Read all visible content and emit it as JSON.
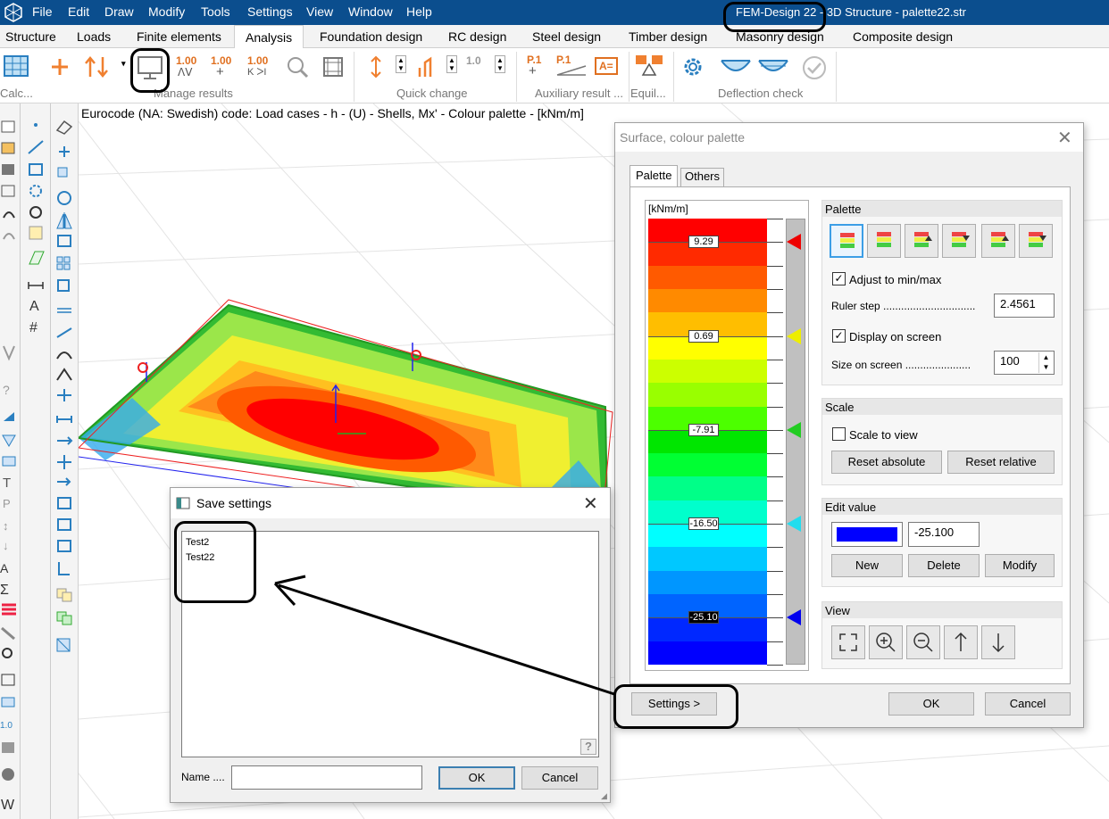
{
  "app": {
    "title": "FEM-Design 22 - 3D Structure - palette22.str"
  },
  "menu": [
    "File",
    "Edit",
    "Draw",
    "Modify",
    "Tools",
    "Settings",
    "View",
    "Window",
    "Help"
  ],
  "tabs": [
    "Structure",
    "Loads",
    "Finite elements",
    "Analysis",
    "Foundation design",
    "RC design",
    "Steel design",
    "Timber design",
    "Masonry design",
    "Composite design"
  ],
  "active_tab": "Analysis",
  "ribbon": {
    "groups": [
      "Calc...",
      "Manage results",
      "Quick change",
      "Auxiliary result ...",
      "Equil...",
      "Deflection check"
    ],
    "num_labels": [
      "1.00",
      "1.00",
      "1.00",
      "1.0"
    ],
    "aux_labels": [
      "P.1",
      "P.1",
      "A="
    ]
  },
  "caption": "Eurocode (NA: Swedish) code: Load cases - h - (U) - Shells, Mx' - Colour palette - [kNm/m]",
  "palette_dialog": {
    "title": "Surface, colour palette",
    "tabs": [
      "Palette",
      "Others"
    ],
    "unit": "[kNm/m]",
    "bands": [
      "#ff0000",
      "#ff2a00",
      "#ff5a00",
      "#ff8a00",
      "#ffbe00",
      "#ffff00",
      "#ccff00",
      "#99ff00",
      "#4cff00",
      "#00e600",
      "#00ff33",
      "#00ff88",
      "#00ffcc",
      "#00ffff",
      "#00c8ff",
      "#0096ff",
      "#0064ff",
      "#0028ff",
      "#0000ff"
    ],
    "markers": [
      {
        "label": "9.29",
        "color": "#ee0000",
        "dark": false
      },
      {
        "label": "0.69",
        "color": "#eeee00",
        "dark": false
      },
      {
        "label": "-7.91",
        "color": "#22cc22",
        "dark": false
      },
      {
        "label": "-16.50",
        "color": "#22ddee",
        "dark": false
      },
      {
        "label": "-25.10",
        "color": "#0000ee",
        "dark": true
      }
    ],
    "palette_group": {
      "title": "Palette",
      "adjust_label": "Adjust to min/max",
      "adjust_checked": "✓",
      "ruler_step_label": "Ruler step ...............................",
      "ruler_step": "2.4561",
      "display_label": "Display on screen",
      "display_checked": "✓",
      "size_label": "Size on screen ......................",
      "size_value": "100"
    },
    "scale_group": {
      "title": "Scale",
      "scale_to_view": "Scale to view",
      "reset_absolute": "Reset absolute",
      "reset_relative": "Reset relative"
    },
    "edit_group": {
      "title": "Edit value",
      "color": "#0000ff",
      "value": "-25.100",
      "new": "New",
      "delete": "Delete",
      "modify": "Modify"
    },
    "view_group": {
      "title": "View"
    },
    "settings_button": "Settings >",
    "ok": "OK",
    "cancel": "Cancel"
  },
  "save_dialog": {
    "title": "Save settings",
    "items": [
      "Test2",
      "Test22"
    ],
    "name_label": "Name ....",
    "name_value": "",
    "ok": "OK",
    "cancel": "Cancel",
    "help": "?"
  }
}
